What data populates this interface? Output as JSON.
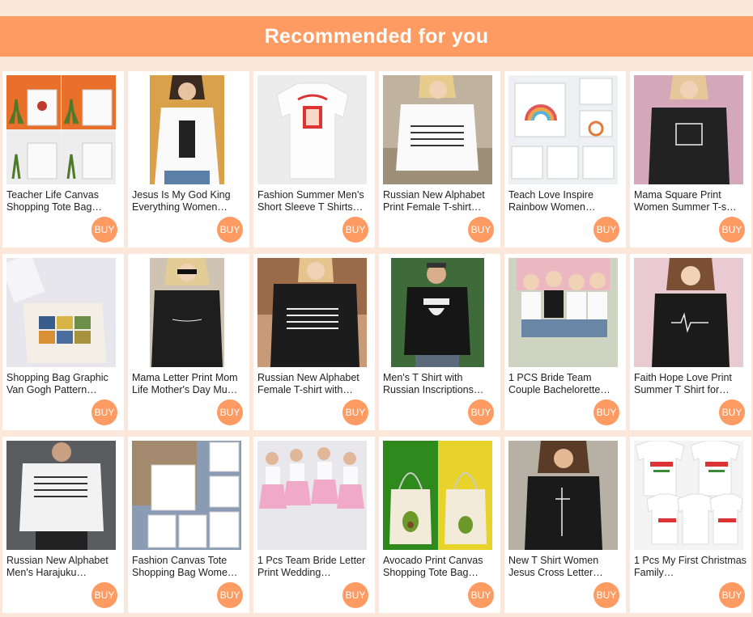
{
  "header": {
    "title": "Recommended for you"
  },
  "colors": {
    "accent": "#fe9b62",
    "page_bg": "#fbe8db"
  },
  "buy_label": "BUY",
  "products": [
    {
      "title": "Teacher Life Canvas Shopping Tote Bag…",
      "image": "tote-bags-love-teacher"
    },
    {
      "title": "Jesus Is My God King Everything Women…",
      "image": "woman-white-tee-jesus-text"
    },
    {
      "title": "Fashion Summer Men's Short Sleeve T Shirts…",
      "image": "white-tee-doner-kebab"
    },
    {
      "title": "Russian New Alphabet Print Female T-shirt…",
      "image": "woman-white-tee-alphabet"
    },
    {
      "title": "Teach Love Inspire Rainbow Women…",
      "image": "rainbow-tote-bags"
    },
    {
      "title": "Mama Square Print Women Summer T-s…",
      "image": "woman-black-tee-mama"
    },
    {
      "title": "Shopping Bag Graphic Van Gogh Pattern…",
      "image": "van-gogh-tote-bag"
    },
    {
      "title": "Mama Letter Print Mom Life Mother's Day Mu…",
      "image": "woman-black-tee-mama-script"
    },
    {
      "title": "Russian New Alphabet Female T-shirt with…",
      "image": "woman-black-tee-alphabet"
    },
    {
      "title": "Men's T Shirt with Russian Inscriptions…",
      "image": "man-black-tee-beard"
    },
    {
      "title": "1 PCS Bride Team Couple Bachelorette…",
      "image": "bride-team-group"
    },
    {
      "title": "Faith Hope Love Print Summer T Shirt for…",
      "image": "woman-black-tee-heartbeat"
    },
    {
      "title": "Russian New Alphabet Men's Harajuku…",
      "image": "man-white-tee-alphabet"
    },
    {
      "title": "Fashion Canvas Tote Shopping Bag Wome…",
      "image": "text-tote-bags"
    },
    {
      "title": "1 Pcs Team Bride Letter Print Wedding…",
      "image": "team-bride-dancing"
    },
    {
      "title": "Avocado Print Canvas Shopping Tote Bag…",
      "image": "avocado-tote-bags"
    },
    {
      "title": "New T Shirt Women Jesus Cross Letter…",
      "image": "woman-black-tee-jesus-cross"
    },
    {
      "title": "1 Pcs My First Christmas Family…",
      "image": "my-first-christmas-tees"
    }
  ]
}
